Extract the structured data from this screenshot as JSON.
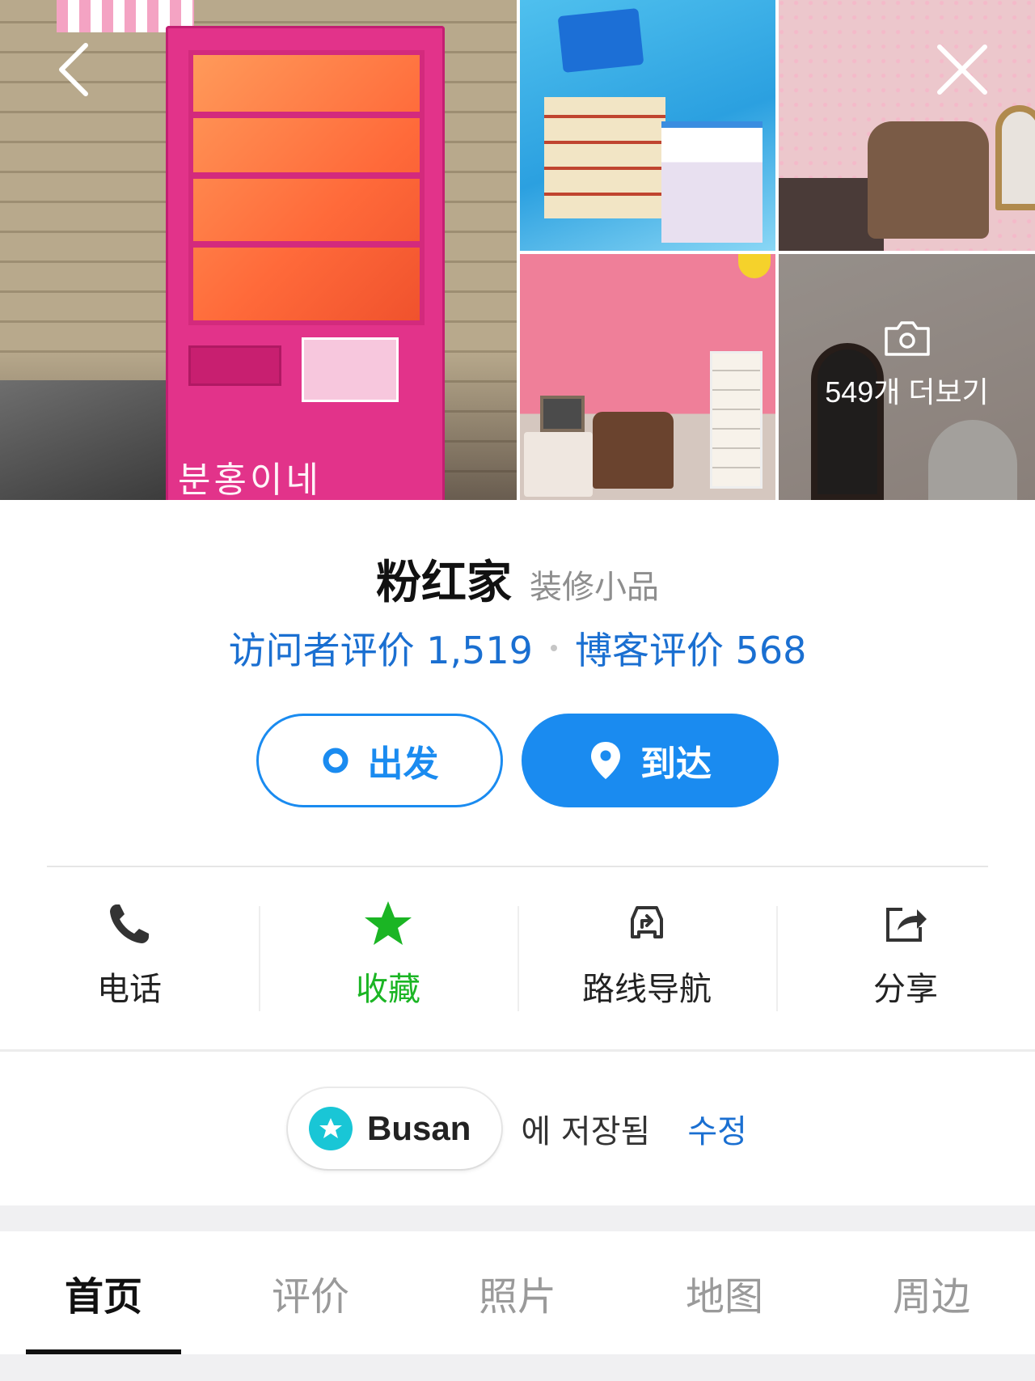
{
  "gallery": {
    "door_text": "분홍이네",
    "more_label": "549개 더보기"
  },
  "place": {
    "name": "粉红家",
    "category": "装修小品",
    "visitor_reviews": "访问者评价 1,519",
    "blog_reviews": "博客评价 568"
  },
  "buttons": {
    "depart": "出发",
    "arrive": "到达"
  },
  "actions": [
    {
      "label": "电话",
      "icon": "phone-icon"
    },
    {
      "label": "收藏",
      "icon": "star-icon"
    },
    {
      "label": "路线导航",
      "icon": "route-icon"
    },
    {
      "label": "分享",
      "icon": "share-icon"
    }
  ],
  "saved": {
    "list_name": "Busan",
    "text": "에 저장됨",
    "edit": "수정"
  },
  "tabs": [
    "首页",
    "评价",
    "照片",
    "地图",
    "周边"
  ],
  "colors": {
    "accent_blue": "#1a8bf0",
    "link_blue": "#1a6fd1",
    "favorite_green": "#1bb524",
    "saved_teal": "#19c6d6"
  }
}
